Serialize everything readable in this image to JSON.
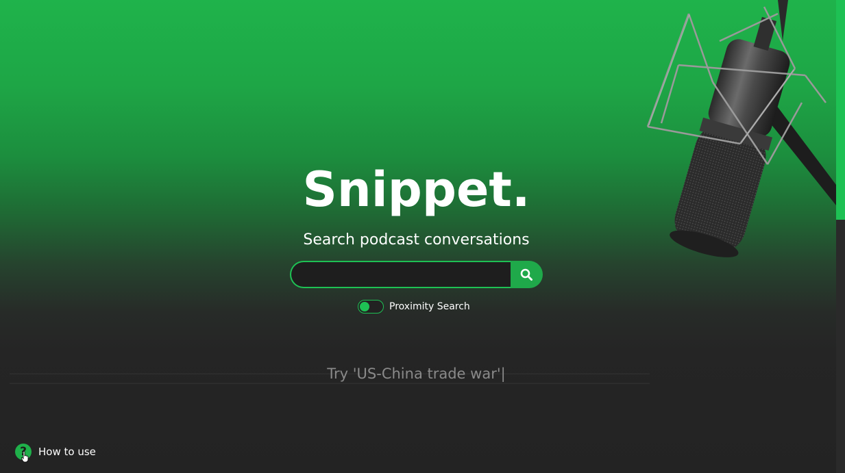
{
  "app": {
    "title": "Snippet.",
    "subtitle": "Search podcast conversations"
  },
  "search": {
    "value": "",
    "placeholder": "",
    "button_icon": "search-icon"
  },
  "proximity": {
    "label": "Proximity Search",
    "enabled": false
  },
  "suggestion": {
    "text": "Try  'US-China trade war'|"
  },
  "help": {
    "icon": "question-icon",
    "label": "How to use"
  },
  "colors": {
    "accent": "#1ec154",
    "accent_dark": "#1fa94a",
    "background_dark": "#232323",
    "background_green": "#1fb34b"
  },
  "decor": {
    "hero_image": "microphone-image"
  }
}
